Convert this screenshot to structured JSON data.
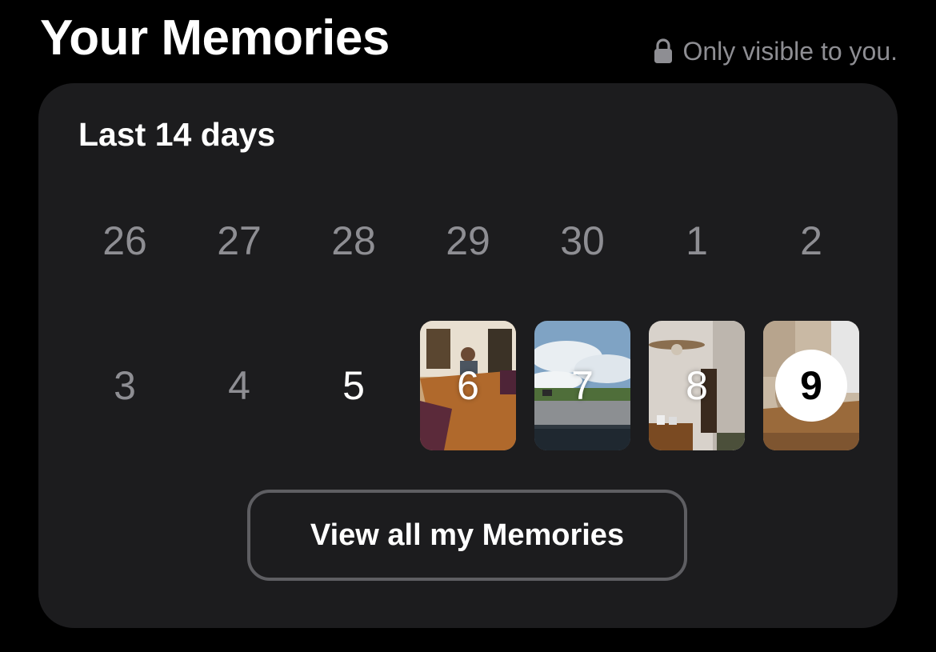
{
  "header": {
    "title": "Your Memories",
    "privacy_text": "Only visible to you.",
    "privacy_icon": "lock-icon"
  },
  "card": {
    "title": "Last 14 days",
    "days": [
      {
        "label": "26",
        "memory": false
      },
      {
        "label": "27",
        "memory": false
      },
      {
        "label": "28",
        "memory": false
      },
      {
        "label": "29",
        "memory": false
      },
      {
        "label": "30",
        "memory": false
      },
      {
        "label": "1",
        "memory": false
      },
      {
        "label": "2",
        "memory": false
      },
      {
        "label": "3",
        "memory": false
      },
      {
        "label": "4",
        "memory": false
      },
      {
        "label": "5",
        "memory": false,
        "highlight": true
      },
      {
        "label": "6",
        "memory": true
      },
      {
        "label": "7",
        "memory": true
      },
      {
        "label": "8",
        "memory": true
      },
      {
        "label": "9",
        "memory": true,
        "selected": true
      }
    ],
    "button_label": "View all my Memories"
  },
  "colors": {
    "background": "#000000",
    "card": "#1c1c1e",
    "muted_text": "#8e8e93",
    "button_border": "#5e5e62"
  }
}
